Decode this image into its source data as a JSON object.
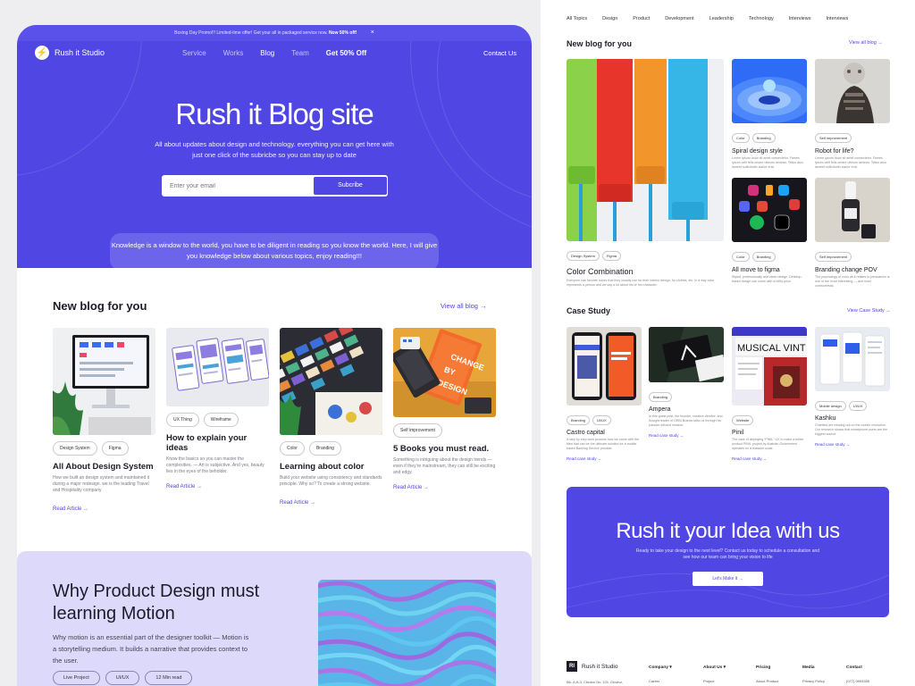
{
  "promo": {
    "text": "Boxing Day Promo!!! Limited-time offer! Get your all in packaged service now.",
    "highlight": "Now 50% off!",
    "close": "×"
  },
  "brand": {
    "name": "Rush it Studio",
    "mark": "⚡",
    "accent": "#5046E4"
  },
  "nav": {
    "items": [
      "Service",
      "Works",
      "Blog",
      "Team"
    ],
    "active": "Blog",
    "offer": "Get 50% Off",
    "contact": "Contact Us"
  },
  "hero": {
    "title": "Rush it Blog site",
    "subtitle": "All about updates about design and technology. everything you can get here with just one click of the subricbe so you can stay up to date",
    "email_placeholder": "Enter your email",
    "subscribe_label": "Subcribe",
    "knowledge": "Knowledge is a window to the world, you have to be diligent in reading so you know the world. Here, I will give you knowledge below about various topics, enjoy reading!!!"
  },
  "new_blog": {
    "title": "New blog for you",
    "view_all": "View all blog",
    "cards": [
      {
        "tags": [
          "Design System",
          "Figma"
        ],
        "title": "All About Design System",
        "desc": "How we built an design system and maintained it during a major redesign. we is the leading Travel and Hospitality company",
        "read": "Read Article"
      },
      {
        "tags": [
          "UX Thing",
          "Wireframe"
        ],
        "title": "How to explain your ideas",
        "desc": "Know the basics so you can master the complexities. — Art is subjective. And yes, beauty lies in the eyes of the beholder.",
        "read": "Read Article"
      },
      {
        "tags": [
          "Color",
          "Branding"
        ],
        "title": "Learning about color",
        "desc": "Build your website using consistency and standards principle. Why so? To create a strong website.",
        "read": "Read Article"
      },
      {
        "tags": [
          "Self improvement"
        ],
        "title": "5 Books you must read.",
        "desc": "Something is intriguing about the design trends — even if they’re mainstream, they can still be exciting and edgy.",
        "read": "Read Article"
      }
    ]
  },
  "motion": {
    "title": "Why Product Design must learning Motion",
    "desc": "Why motion is an essential part of the designer toolkit — Motion is a storytelling medium. It builds a narrative that provides context to the user.",
    "tags": [
      "Live Project",
      "UI/UX",
      "12 Min read"
    ]
  },
  "right": {
    "topics": [
      "All Topics",
      "Design",
      "Product",
      "Development",
      "Leadership",
      "Technology",
      "Interviews",
      "Interviews"
    ],
    "new_blog_title": "New blog for you",
    "view_all": "View all blog",
    "big_card": {
      "tags": [
        "Design System",
        "Figma"
      ],
      "title": "Color Combination",
      "desc": "Everyone has favorite colors that they usually use for their interior design, for clothes, etc. In a way color represents a person and we say a lot about his or her character."
    },
    "small_cards": [
      {
        "tags": [
          "Color",
          "Branding"
        ],
        "title": "Spiral design style",
        "desc": "Lorem ipsum dolor sit amet consectetur. Fames ipsum velit felis omare ultrices aenean. Tellus arcu laoreet sollicitudin auctor erat."
      },
      {
        "tags": [
          "Self improvement"
        ],
        "title": "Robot for life?",
        "desc": "Lorem ipsum dolor sit amet consectetur. Fames ipsum velit felis omare ultrices aenean. Tellus arcu laoreet sollicitudin auctor erat."
      },
      {
        "tags": [
          "Color",
          "Branding"
        ],
        "title": "All move to figma",
        "desc": "Styled, professionally and clean design. Desktop-based design can come with a hefty price."
      },
      {
        "tags": [
          "Self improvement"
        ],
        "title": "Branding change POV",
        "desc": "The psychology of color as it relates to persuasion is one of the most interesting — and most controversial."
      }
    ],
    "case_title": "Case Study",
    "case_view": "View Case Study",
    "cases": [
      {
        "tags": [
          "Branding",
          "UI/UX"
        ],
        "title": "Castro capital",
        "desc": "A step by step work process how we came with the idea that can be the ultimate solution for a mobile based Banking Service provider.",
        "read": "Read case study"
      },
      {
        "tags": [
          "Branding"
        ],
        "title": "Ampera",
        "desc": "In this guest post, the founder, creative director, and thought leader of ORBI Brands talks us through his passion-infused mission.",
        "read": "Read case study"
      },
      {
        "tags": [
          "Website"
        ],
        "title": "Pinil",
        "desc": "The case of deploying “PINIL” UX to make a better product PINIL project by Austrian Government operates on a massive scale.",
        "read": "Read case study"
      },
      {
        "tags": [
          "Mobile design",
          "UI/UX"
        ],
        "title": "Kashku",
        "desc": "Charities are missing out on the mobile revolution. Our research shows that smartphone users are the biggest source.",
        "read": "Read case study"
      }
    ],
    "cta": {
      "title": "Rush it your Idea with us",
      "sub": "Ready to take your design to the next level? Contact us today to schedule a consultation and see how our team can bring your vision to life",
      "button": "Let's Make it"
    },
    "footer": {
      "brand": "Rush it Studio",
      "badge": "RI",
      "address": "Blk. A-B-3, Cibubur No. 125, Cibubur,",
      "cols": [
        {
          "title": "Company ▾",
          "item": "Career"
        },
        {
          "title": "About Us ▾",
          "item": "Project"
        },
        {
          "title": "Pricing",
          "item": "About Product"
        },
        {
          "title": "Media",
          "item": "Privacy Policy"
        },
        {
          "title": "Contact",
          "item": "(077) 0993355"
        }
      ]
    },
    "musical_text": "MUSICAL VINT"
  }
}
